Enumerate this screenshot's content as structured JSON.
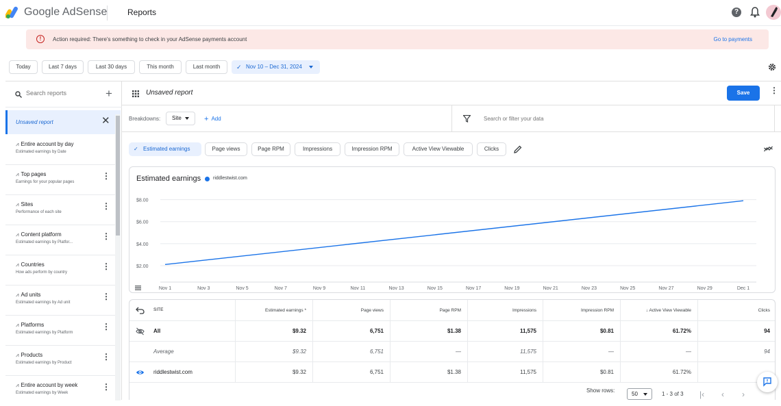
{
  "header": {
    "brand": "Google AdSense",
    "page_title": "Reports"
  },
  "alert": {
    "text": "Action required: There's something to check in your AdSense payments account",
    "link": "Go to payments"
  },
  "date_chips": [
    "Today",
    "Last 7 days",
    "Last 30 days",
    "This month",
    "Last month"
  ],
  "date_range": "Nov 10 – Dec 31, 2024",
  "sidebar": {
    "search_placeholder": "Search reports",
    "active_report": "Unsaved report",
    "items": [
      {
        "title": "Entire account by day",
        "subtitle": "Estimated earnings by Date"
      },
      {
        "title": "Top pages",
        "subtitle": "Earnings for your popular pages"
      },
      {
        "title": "Sites",
        "subtitle": "Performance of each site"
      },
      {
        "title": "Content platform",
        "subtitle": "Estimated earnings by Platfor..."
      },
      {
        "title": "Countries",
        "subtitle": "How ads perform by country"
      },
      {
        "title": "Ad units",
        "subtitle": "Estimated earnings by Ad unit"
      },
      {
        "title": "Platforms",
        "subtitle": "Estimated earnings by Platform"
      },
      {
        "title": "Products",
        "subtitle": "Estimated earnings by Product"
      },
      {
        "title": "Entire account by week",
        "subtitle": "Estimated earnings by Week"
      }
    ]
  },
  "report": {
    "title": "Unsaved report",
    "save_label": "Save",
    "breakdowns_label": "Breakdowns:",
    "breakdown_value": "Site",
    "add_label": "Add",
    "filter_placeholder": "Search or filter your data"
  },
  "metrics": {
    "active": "Estimated earnings",
    "others": [
      "Page views",
      "Page RPM",
      "Impressions",
      "Impression RPM",
      "Active View Viewable",
      "Clicks"
    ]
  },
  "chart_data": {
    "type": "line",
    "title": "Estimated earnings",
    "series": [
      {
        "name": "riddlestwist.com",
        "color": "#1a73e8",
        "x": [
          "Nov 1",
          "Dec 1"
        ],
        "values": [
          2.1,
          7.9
        ]
      }
    ],
    "y_ticks": [
      "$8.00",
      "$6.00",
      "$4.00",
      "$2.00"
    ],
    "y_tick_values": [
      8,
      6,
      4,
      2
    ],
    "x_ticks": [
      "Nov 1",
      "Nov 3",
      "Nov 5",
      "Nov 7",
      "Nov 9",
      "Nov 11",
      "Nov 13",
      "Nov 15",
      "Nov 17",
      "Nov 19",
      "Nov 21",
      "Nov 23",
      "Nov 25",
      "Nov 27",
      "Nov 29",
      "Dec 1"
    ],
    "grid": true
  },
  "table": {
    "headers": [
      "SITE",
      "Estimated earnings *",
      "Page views",
      "Page RPM",
      "Impressions",
      "Impression RPM",
      "↓ Active View Viewable",
      "Clicks"
    ],
    "rows": [
      {
        "name": "All",
        "values": [
          "$9.32",
          "6,751",
          "$1.38",
          "11,575",
          "$0.81",
          "61.72%",
          "94"
        ]
      },
      {
        "name": "Average",
        "values": [
          "$9.32",
          "6,751",
          "—",
          "11,575",
          "—",
          "—",
          "94"
        ]
      },
      {
        "name": "riddlestwist.com",
        "values": [
          "$9.32",
          "6,751",
          "$1.38",
          "11,575",
          "$0.81",
          "61.72%",
          ""
        ]
      }
    ],
    "show_rows_label": "Show rows:",
    "rows_value": "50",
    "range_label": "1 - 3 of 3"
  },
  "colors": {
    "accent": "#1a73e8",
    "alert_bg": "#fce8e6",
    "alert_icon": "#c5221f"
  }
}
